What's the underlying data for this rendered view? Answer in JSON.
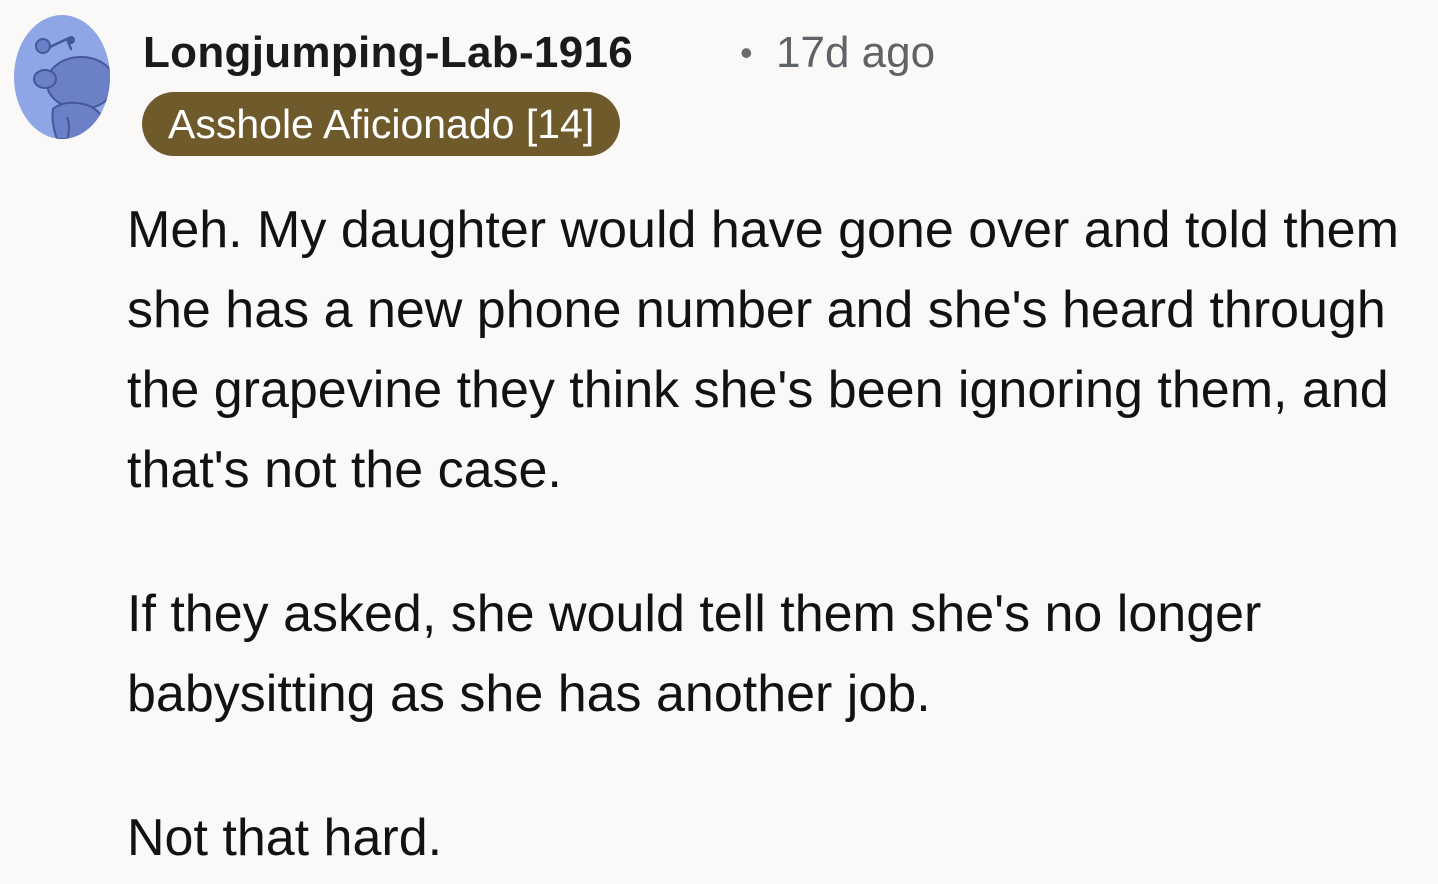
{
  "comment": {
    "author": "Longjumping-Lab-1916",
    "separator": "•",
    "timestamp": "17d ago",
    "flair": "Asshole Aficionado [14]",
    "avatar_icon": "snoo-avatar-icon",
    "paragraphs": [
      "Meh.   My daughter would have gone over and told them she has a new phone number and she's heard through the grapevine they think she's been ignoring them, and that's not the case.",
      "If they asked, she would tell them she's no longer babysitting as she has another job.",
      "Not that hard."
    ]
  },
  "colors": {
    "background": "#faf9f7",
    "flair_background": "#6e5a2a",
    "avatar": "#8fa6e6",
    "text": "#121212",
    "meta_text": "#5f6266"
  }
}
